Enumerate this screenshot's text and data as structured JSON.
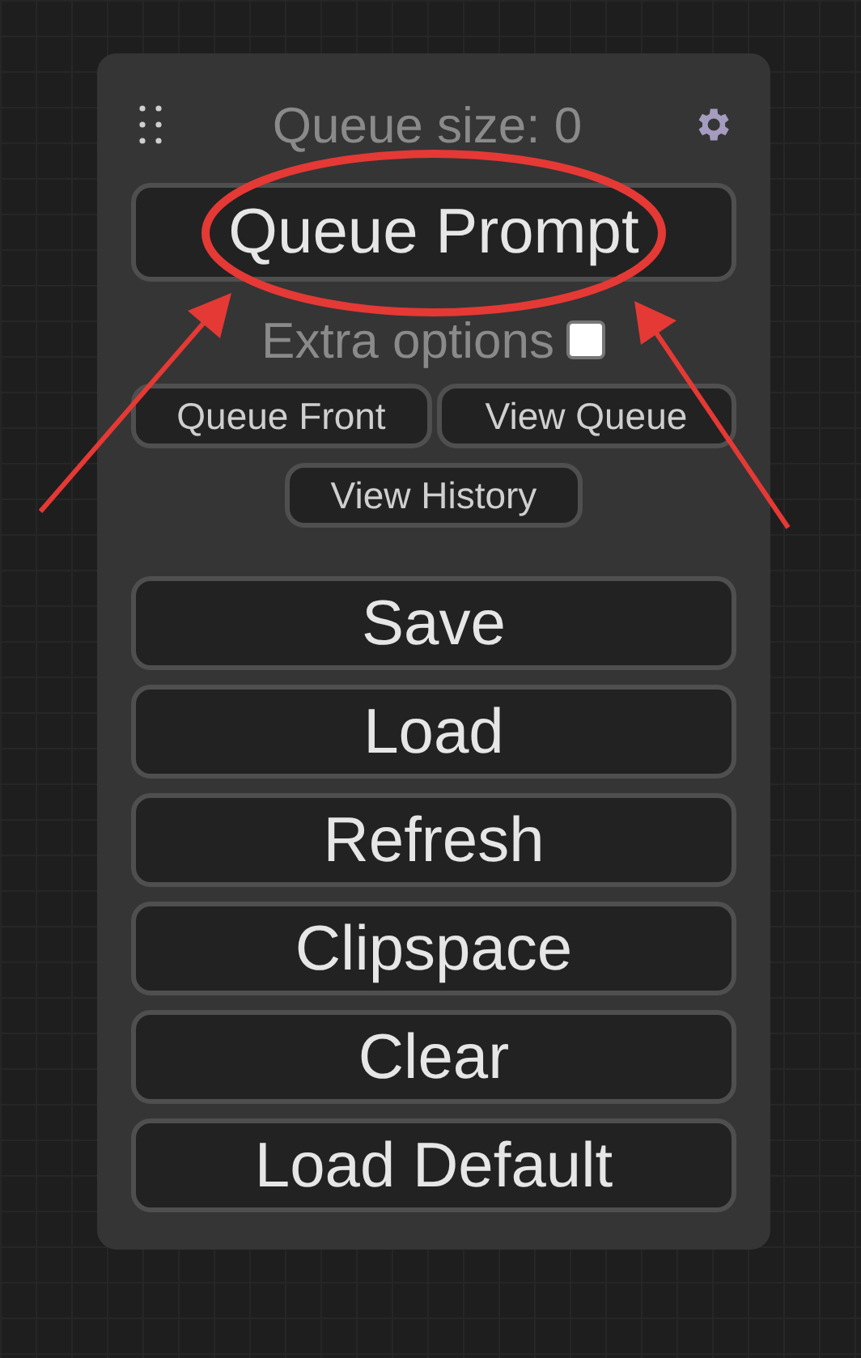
{
  "menu": {
    "queue_size": "Queue size: 0",
    "queue_button": "Queue Prompt",
    "extra_options": {
      "label": "Extra options",
      "checked": false
    },
    "small_buttons": [
      "Queue Front",
      "View Queue",
      "View History"
    ],
    "buttons": [
      "Save",
      "Load",
      "Refresh",
      "Clipspace",
      "Clear",
      "Load Default"
    ]
  }
}
